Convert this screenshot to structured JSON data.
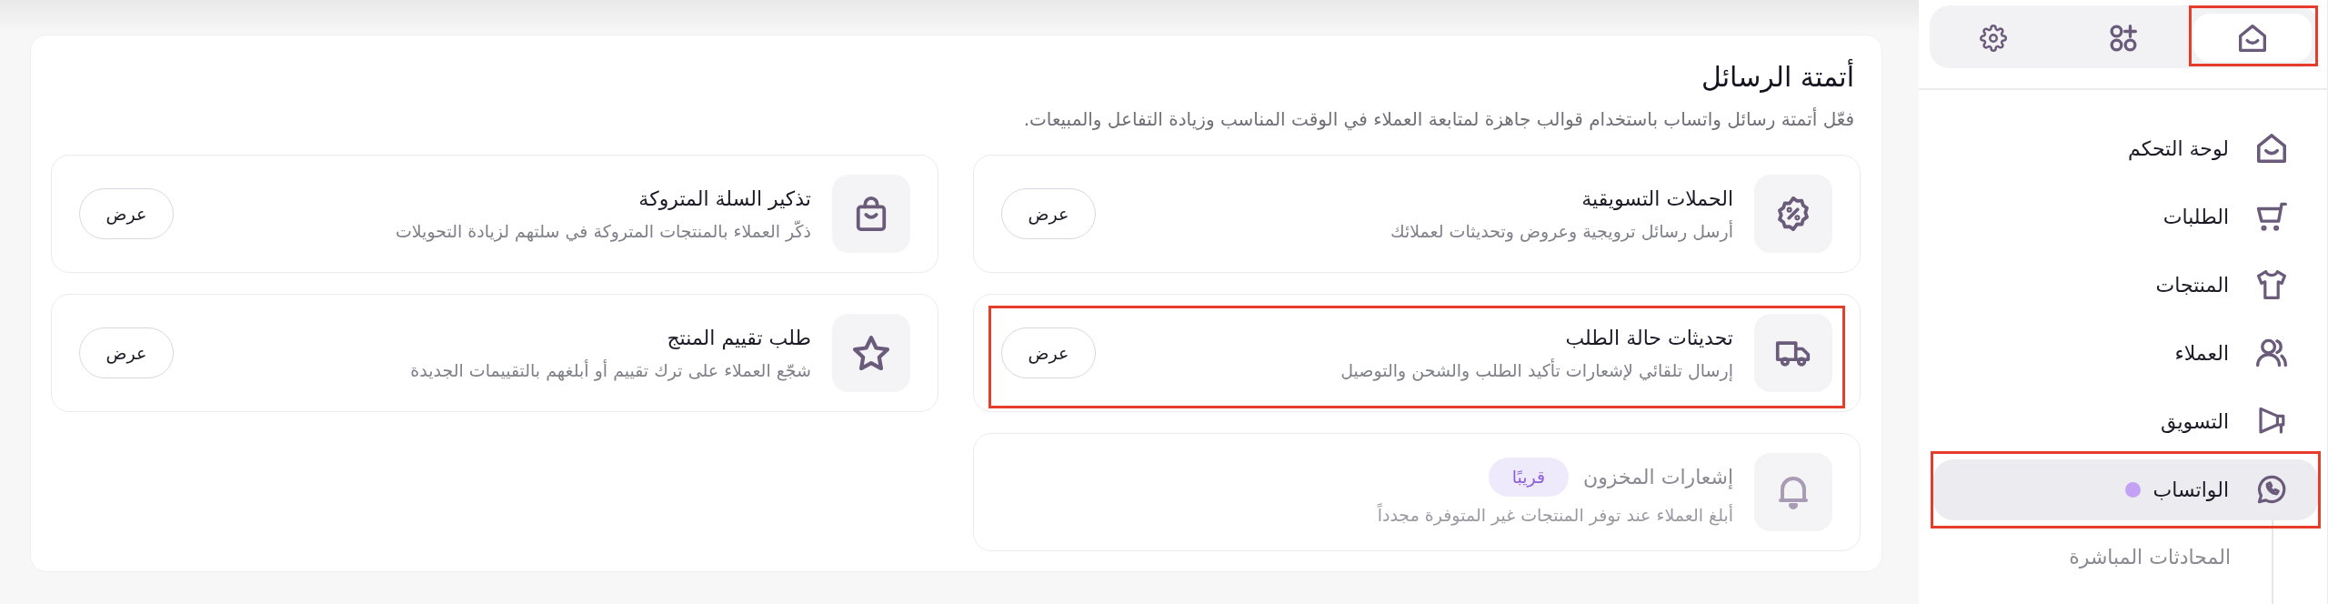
{
  "sidebar": {
    "tabs": [
      {
        "selected": true,
        "highlighted": true
      },
      {
        "selected": false,
        "highlighted": false
      },
      {
        "selected": false,
        "highlighted": false
      }
    ],
    "nav_items": [
      {
        "label": "لوحة التحكم",
        "selected": false,
        "dot": false,
        "highlighted": false
      },
      {
        "label": "الطلبات",
        "selected": false,
        "dot": false,
        "highlighted": false
      },
      {
        "label": "المنتجات",
        "selected": false,
        "dot": false,
        "highlighted": false
      },
      {
        "label": "العملاء",
        "selected": false,
        "dot": false,
        "highlighted": false
      },
      {
        "label": "التسويق",
        "selected": false,
        "dot": false,
        "highlighted": false
      },
      {
        "label": "الواتساب",
        "selected": true,
        "dot": true,
        "highlighted": true,
        "children": [
          {
            "label": "المحادثات المباشرة",
            "selected": false
          }
        ]
      }
    ]
  },
  "main": {
    "title": "أتمتة الرسائل",
    "subtitle": "فعّل أتمتة رسائل واتساب باستخدام قوالب جاهزة لمتابعة العملاء في الوقت المناسب وزيادة التفاعل والمبيعات.",
    "cards": [
      {
        "title": "الحملات التسويقية",
        "description": "أرسل رسائل ترويجية وعروض وتحديثات لعملائك",
        "button": "عرض",
        "disabled": false,
        "highlighted": false
      },
      {
        "title": "تذكير السلة المتروكة",
        "description": "ذكّر العملاء بالمنتجات المتروكة في سلتهم لزيادة التحويلات",
        "button": "عرض",
        "disabled": false,
        "highlighted": false
      },
      {
        "title": "تحديثات حالة الطلب",
        "description": "إرسال تلقائي لإشعارات تأكيد الطلب والشحن والتوصيل",
        "button": "عرض",
        "disabled": false,
        "highlighted": true
      },
      {
        "title": "طلب تقييم المنتج",
        "description": "شجّع العملاء على ترك تقييم أو أبلغهم بالتقييمات الجديدة",
        "button": "عرض",
        "disabled": false,
        "highlighted": false
      },
      {
        "title": "إشعارات المخزون",
        "badge": "قريبًا",
        "description": "أبلغ العملاء عند توفر المنتجات غير المتوفرة مجدداً",
        "disabled": true,
        "highlighted": false
      }
    ]
  }
}
